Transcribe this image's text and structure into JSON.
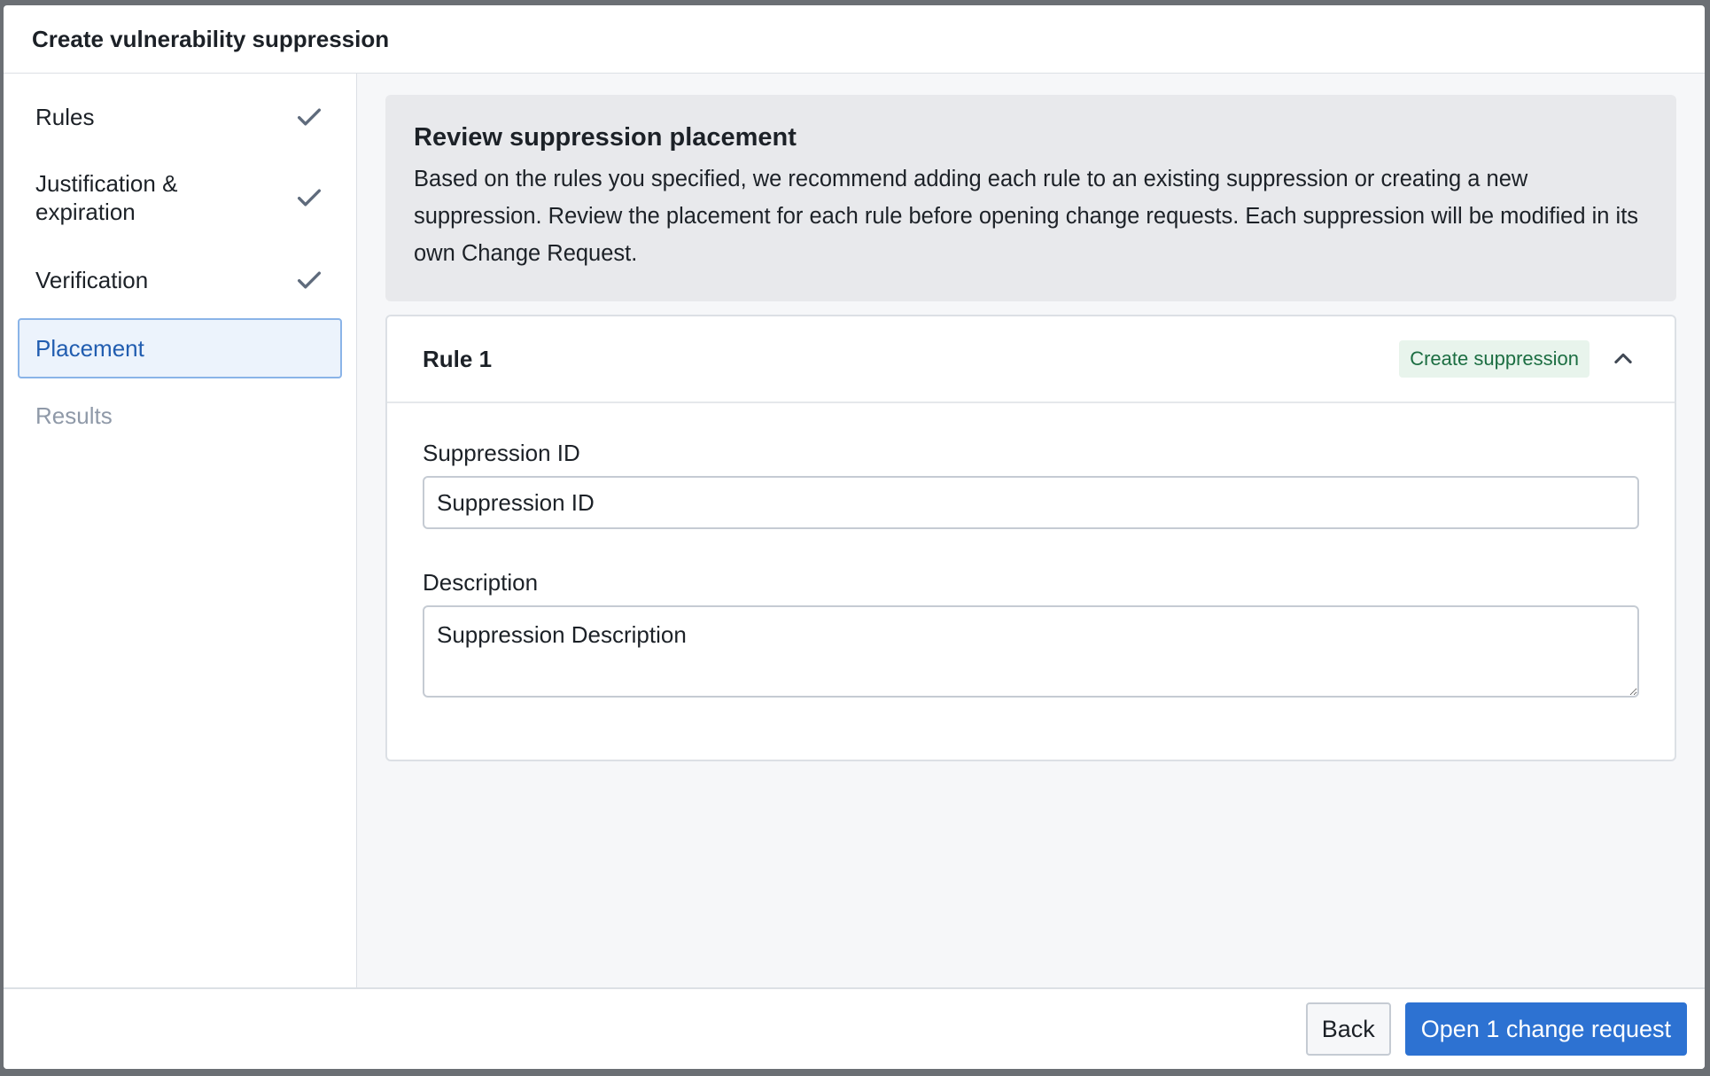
{
  "dialog": {
    "title": "Create vulnerability suppression"
  },
  "steps": [
    {
      "label": "Rules",
      "status": "complete"
    },
    {
      "label": "Justification & expiration",
      "status": "complete"
    },
    {
      "label": "Verification",
      "status": "complete"
    },
    {
      "label": "Placement",
      "status": "active"
    },
    {
      "label": "Results",
      "status": "pending"
    }
  ],
  "callout": {
    "title": "Review suppression placement",
    "text": "Based on the rules you specified, we recommend adding each rule to an existing suppression or creating a new suppression. Review the placement for each rule before opening change requests. Each suppression will be modified in its own Change Request."
  },
  "rule": {
    "title": "Rule 1",
    "tag": "Create suppression",
    "suppression_id_label": "Suppression ID",
    "suppression_id_placeholder": "Suppression ID",
    "description_label": "Description",
    "description_placeholder": "Suppression Description"
  },
  "footer": {
    "back_label": "Back",
    "submit_label": "Open 1 change request"
  },
  "colors": {
    "primary": "#2d72d2",
    "active_step_bg": "#ecf3fc",
    "tag_green": "#1c6e42"
  }
}
